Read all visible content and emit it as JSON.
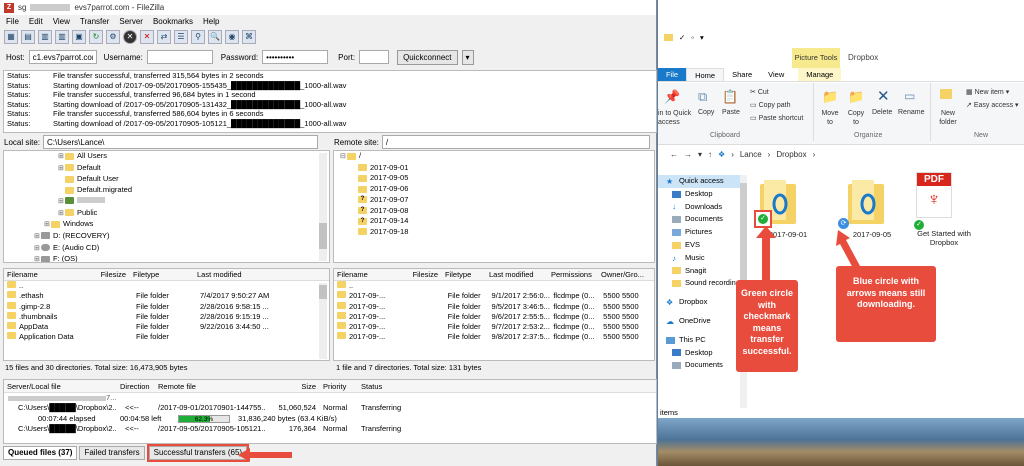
{
  "filezilla": {
    "title": "evs7parrot.com - FileZilla",
    "title_prefix": "sg",
    "menu": [
      "File",
      "Edit",
      "View",
      "Transfer",
      "Server",
      "Bookmarks",
      "Help"
    ],
    "quickconnect": {
      "host_label": "Host:",
      "host_value": "c1.evs7parrot.com",
      "username_label": "Username:",
      "username_value": "",
      "password_label": "Password:",
      "password_value": "••••••••••",
      "port_label": "Port:",
      "port_value": "",
      "button": "Quickconnect"
    },
    "log": [
      {
        "k": "Status:",
        "v": "File transfer successful, transferred 315,564 bytes in 2 seconds"
      },
      {
        "k": "Status:",
        "v": "Starting download of /2017-09-05/20170905-155435_█████████████_1000-all.wav"
      },
      {
        "k": "Status:",
        "v": "File transfer successful, transferred 96,684 bytes in 1 second"
      },
      {
        "k": "Status:",
        "v": "Starting download of /2017-09-05/20170905-131432_█████████████_1000-all.wav"
      },
      {
        "k": "Status:",
        "v": "File transfer successful, transferred 586,604 bytes in 6 seconds"
      },
      {
        "k": "Status:",
        "v": "Starting download of /2017-09-05/20170905-105121_█████████████_1000-all.wav"
      }
    ],
    "local_site_label": "Local site:",
    "local_site_value": "C:\\Users\\Lance\\",
    "remote_site_label": "Remote site:",
    "remote_site_value": "/",
    "local_tree": [
      "All Users",
      "Default",
      "Default User",
      "Default.migrated",
      "",
      "Public",
      "Windows",
      "D: (RECOVERY)",
      "E: (Audio CD)",
      "F: (OS)"
    ],
    "remote_tree": [
      "/",
      "2017-09-01",
      "2017-09-05",
      "2017-09-06",
      "2017-09-07",
      "2017-09-08",
      "2017-09-14",
      "2017-09-18"
    ],
    "local_headers": [
      "Filename",
      "Filesize",
      "Filetype",
      "Last modified"
    ],
    "local_files": [
      [
        "..",
        "",
        "",
        ""
      ],
      [
        ".ethash",
        "",
        "File folder",
        "7/4/2017 9:50:27 AM"
      ],
      [
        ".gimp-2.8",
        "",
        "File folder",
        "2/28/2016 9:58:15 ..."
      ],
      [
        ".thumbnails",
        "",
        "File folder",
        "2/28/2016 9:15:19 ..."
      ],
      [
        "AppData",
        "",
        "File folder",
        "9/22/2016 3:44:50 ..."
      ],
      [
        "Application Data",
        "",
        "File folder",
        ""
      ]
    ],
    "local_status": "15 files and 30 directories. Total size: 16,473,905 bytes",
    "remote_headers": [
      "Filename",
      "Filesize",
      "Filetype",
      "Last modified",
      "Permissions",
      "Owner/Gro..."
    ],
    "remote_files": [
      [
        "..",
        "",
        "",
        "",
        "",
        ""
      ],
      [
        "2017-09-...",
        "",
        "File folder",
        "9/1/2017 2:56:0...",
        "flcdmpe (0...",
        "5500 5500"
      ],
      [
        "2017-09-...",
        "",
        "File folder",
        "9/5/2017 3:46:5...",
        "flcdmpe (0...",
        "5500 5500"
      ],
      [
        "2017-09-...",
        "",
        "File folder",
        "9/6/2017 2:55:5...",
        "flcdmpe (0...",
        "5500 5500"
      ],
      [
        "2017-09-...",
        "",
        "File folder",
        "9/7/2017 2:53:2...",
        "flcdmpe (0...",
        "5500 5500"
      ],
      [
        "2017-09-...",
        "",
        "File folder",
        "9/8/2017 2:37:5...",
        "flcdmpe (0...",
        "5500 5500"
      ]
    ],
    "remote_status": "1 file and 7 directories. Total size: 131 bytes",
    "queue_headers": [
      "Server/Local file",
      "Direction",
      "Remote file",
      "Size",
      "Priority",
      "Status"
    ],
    "queue_rows": [
      {
        "local": "C:\\Users\\█████\\Dropbox\\2...",
        "dir": "<<--",
        "remote": "/2017-09-01/20170901-144755...",
        "size": "51,060,524",
        "priority": "Normal",
        "status": "Transferring"
      },
      {
        "local": "C:\\Users\\█████\\Dropbox\\2...",
        "dir": "<<--",
        "remote": "/2017-09-05/20170905-105121...",
        "size": "176,364",
        "priority": "Normal",
        "status": "Transferring"
      }
    ],
    "queue_first_row": "7...",
    "progress": {
      "elapsed": "00:07:44 elapsed",
      "left": "00:04:58 left",
      "percent": "62.3%",
      "fraction": 0.623,
      "bytes": "31,836,240 bytes (63.4 KiB/s)"
    },
    "tabs": [
      "Queued files (37)",
      "Failed transfers",
      "Successful transfers (65)"
    ]
  },
  "explorer": {
    "title": "Dropbox",
    "picture_tools": "Picture Tools",
    "ribbon_tabs": [
      "File",
      "Home",
      "Share",
      "View",
      "Manage"
    ],
    "clipboard": {
      "pin": "in to Quick access",
      "copy": "Copy",
      "paste": "Paste",
      "cut": "Cut",
      "copy_path": "Copy path",
      "paste_shortcut": "Paste shortcut",
      "group": "Clipboard"
    },
    "organize": {
      "move": "Move to",
      "copy": "Copy to",
      "delete": "Delete",
      "rename": "Rename",
      "group": "Organize"
    },
    "new": {
      "folder": "New folder",
      "item": "New item",
      "easy": "Easy access",
      "group": "New"
    },
    "breadcrumb": [
      "Lance",
      "Dropbox"
    ],
    "nav": [
      "Quick access",
      "Desktop",
      "Downloads",
      "Documents",
      "Pictures",
      "EVS",
      "Music",
      "Snagit",
      "Sound recording",
      "Dropbox",
      "OneDrive",
      "This PC",
      "Desktop",
      "Documents"
    ],
    "items": [
      {
        "name": "2017-09-01",
        "state": "synced"
      },
      {
        "name": "2017-09-05",
        "state": "syncing"
      },
      {
        "name": "Get Started with Dropbox",
        "state": "synced"
      }
    ],
    "status_bar": "items",
    "pdf_label": "PDF"
  },
  "annotations": {
    "green": "Green circle with checkmark means transfer successful.",
    "blue": "Blue circle with arrows means still downloading."
  },
  "colors": {
    "callout": "#e84c3d",
    "accent": "#1979ca",
    "progress": "#1fae37",
    "folder": "#f5d266"
  }
}
